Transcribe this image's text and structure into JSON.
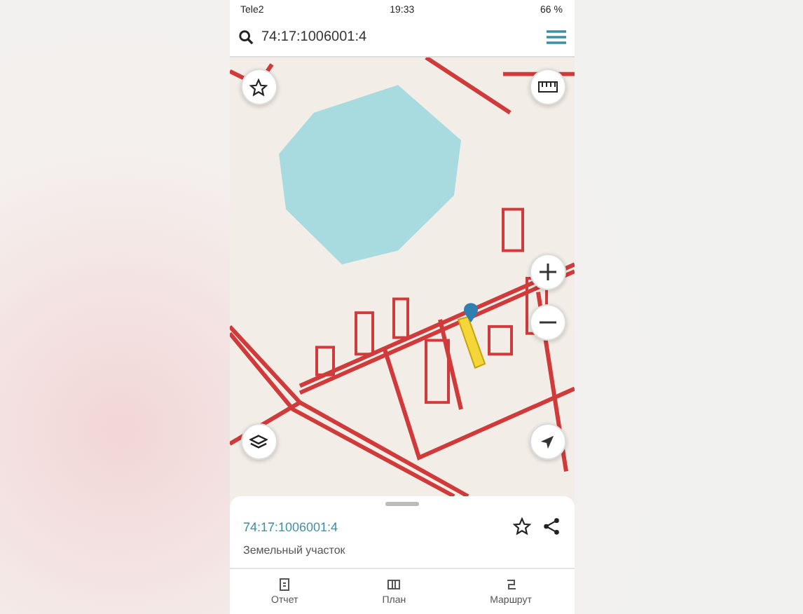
{
  "status_bar": {
    "carrier": "Tele2",
    "time": "19:33",
    "battery": "66 %"
  },
  "search": {
    "value": "74:17:1006001:4"
  },
  "parcel": {
    "number": "74:17:1006001:4",
    "type": "Земельный участок"
  },
  "tabs": [
    {
      "label": "Отчет",
      "kind": "report"
    },
    {
      "label": "План",
      "kind": "plan"
    },
    {
      "label": "Маршрут",
      "kind": "route"
    }
  ]
}
